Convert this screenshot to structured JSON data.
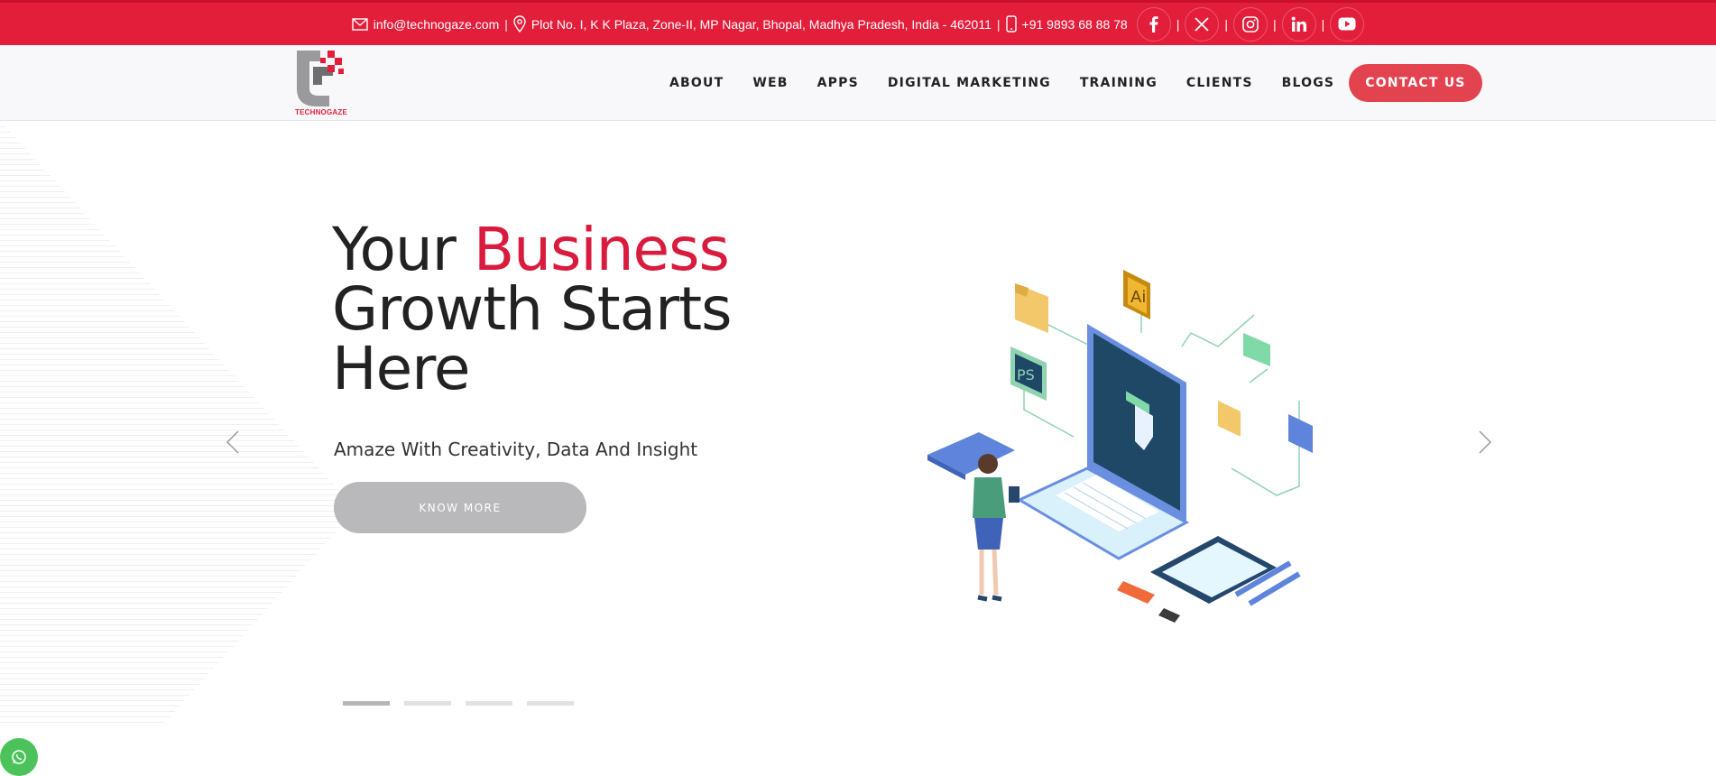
{
  "topbar": {
    "email": "info@technogaze.com",
    "address": "Plot No. I, K K Plaza, Zone-II, MP Nagar, Bhopal, Madhya Pradesh, India - 462011",
    "phone": "+91 9893 68 88 78",
    "separator": "|",
    "socials": [
      "facebook-icon",
      "x-twitter-icon",
      "instagram-icon",
      "linkedin-icon",
      "youtube-icon"
    ]
  },
  "logo": {
    "text": "TECHNOGAZE"
  },
  "nav": {
    "items": [
      "ABOUT",
      "WEB",
      "APPS",
      "DIGITAL MARKETING",
      "TRAINING",
      "CLIENTS",
      "BLOGS"
    ],
    "cta": "CONTACT US"
  },
  "hero": {
    "headline_part1": "Your ",
    "headline_accent": "Business",
    "headline_line2": "Growth Starts",
    "headline_line3": "Here",
    "subline": "Amaze With Creativity, Data And Insight",
    "button": "KNOW MORE",
    "slides_total": 4,
    "active_slide": 1
  },
  "illustration": {
    "label_ai": "Ai",
    "label_ps": "PS"
  },
  "colors": {
    "accent": "#e31e3b",
    "cta": "#e2434f",
    "text": "#222222",
    "button_grey": "#b9b9bb",
    "whatsapp": "#4cc35a"
  }
}
